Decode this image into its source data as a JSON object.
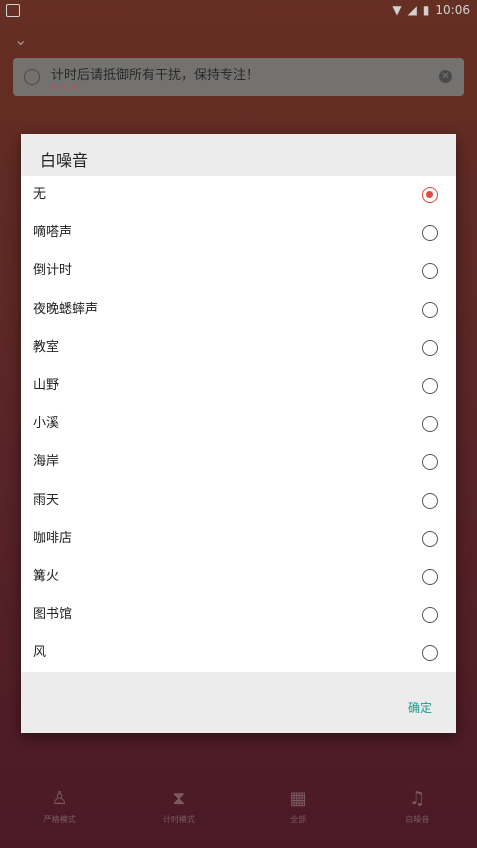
{
  "status_bar": {
    "time": "10:06"
  },
  "notice": {
    "text": "计时后请抵御所有干扰，保持专注！"
  },
  "bottom_nav": [
    {
      "icon": "meditation-icon",
      "label": "严格模式"
    },
    {
      "icon": "hourglass-icon",
      "label": "计时模式"
    },
    {
      "icon": "calendar-icon",
      "label": "全部"
    },
    {
      "icon": "music-note-icon",
      "label": "白噪音"
    }
  ],
  "dialog": {
    "title": "白噪音",
    "confirm_label": "确定",
    "selected_index": 0,
    "options": [
      "无",
      "嘀嗒声",
      "倒计时",
      "夜晚蟋蟀声",
      "教室",
      "山野",
      "小溪",
      "海岸",
      "雨天",
      "咖啡店",
      "篝火",
      "图书馆",
      "风"
    ]
  },
  "colors": {
    "accent": "#1a9a8a",
    "radio_selected": "#e04a40"
  }
}
